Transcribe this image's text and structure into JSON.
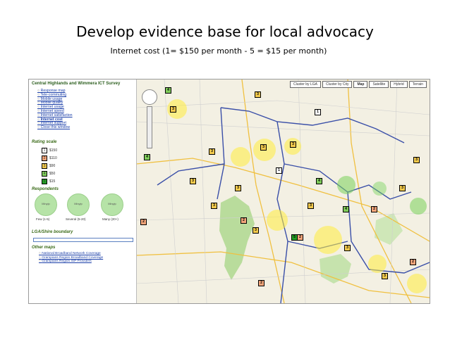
{
  "slide": {
    "title": "Develop evidence base for local advocacy",
    "subtitle": "Internet cost (1= $150 per month - 5 = $15 per month)"
  },
  "panel": {
    "heading": "Central Highlands and Wimmera ICT Survey",
    "nav": [
      "Response map",
      "Tele-commuting",
      "Mobile usage",
      "Mobile quality",
      "Internet usage",
      "Internet speed",
      "Internet satisfaction",
      "Internet cost",
      "Internet support",
      "Close this window"
    ],
    "rating_heading": "Rating scale",
    "ratings": [
      {
        "n": "1",
        "label": "$150",
        "color": "#ffffff"
      },
      {
        "n": "2",
        "label": "$110",
        "color": "#f3a57a"
      },
      {
        "n": "3",
        "label": "$90",
        "color": "#f1c94c"
      },
      {
        "n": "4",
        "label": "$50",
        "color": "#7fcc5a"
      },
      {
        "n": "5",
        "label": "$15",
        "color": "#23a023"
      }
    ],
    "respondents_heading": "Respondents",
    "respondents": [
      {
        "label": "Few (1-5)",
        "bubble": "Minyip"
      },
      {
        "label": "Several (5-20)",
        "bubble": "Minyip"
      },
      {
        "label": "Many (20+)",
        "bubble": "Minyip"
      }
    ],
    "lga_heading": "LGA/Shire boundary",
    "other_heading": "Other maps",
    "other": [
      "National Broadband Network Coverage",
      "Grampians Region Broadband Coverage",
      "Grampians Region ISP Providers"
    ]
  },
  "toolbar": [
    "Cluster by LGA",
    "Cluster by City",
    "Map",
    "Satellite",
    "Hybrid",
    "Terrain"
  ],
  "colors": {
    "halo": "#ffec3c",
    "green_halo": "#78d25a",
    "boundary": "#3a4fa8",
    "park": "#b9dc9c"
  }
}
